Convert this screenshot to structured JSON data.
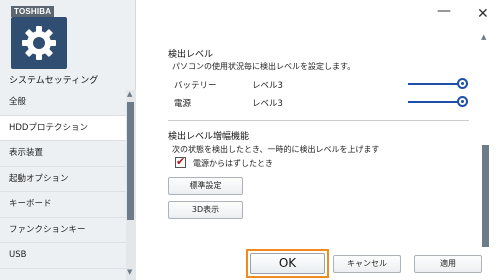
{
  "brand": "TOSHIBA",
  "app_title": "システムセッティング",
  "window_buttons": {
    "minimize": "—",
    "close": "✕"
  },
  "sidebar": {
    "items": [
      {
        "label": "全般"
      },
      {
        "label": "HDDプロテクション"
      },
      {
        "label": "表示装置"
      },
      {
        "label": "起動オプション"
      },
      {
        "label": "キーボード"
      },
      {
        "label": "ファンクションキー"
      },
      {
        "label": "USB"
      }
    ],
    "active_index": 1
  },
  "detection_level": {
    "title": "検出レベル",
    "description": "パソコンの使用状況毎に検出レベルを設定します。",
    "rows": [
      {
        "label": "バッテリー",
        "value": "レベル3",
        "level": 3
      },
      {
        "label": "電源",
        "value": "レベル3",
        "level": 3
      }
    ]
  },
  "amplify": {
    "title": "検出レベル増幅機能",
    "description": "次の状態を検出したとき、一時的に検出レベルを上げます",
    "checkbox_label": "電源からはずしたとき",
    "checked": true
  },
  "buttons": {
    "default": "標準設定",
    "view3d": "3D表示",
    "ok": "OK",
    "cancel": "キャンセル",
    "apply": "適用"
  },
  "colors": {
    "accent": "#1e4fa8",
    "highlight": "#f08c1e",
    "logo_bg": "#2f4e72",
    "check": "#b3151a"
  },
  "icons": {
    "logo": "gear-icon"
  }
}
